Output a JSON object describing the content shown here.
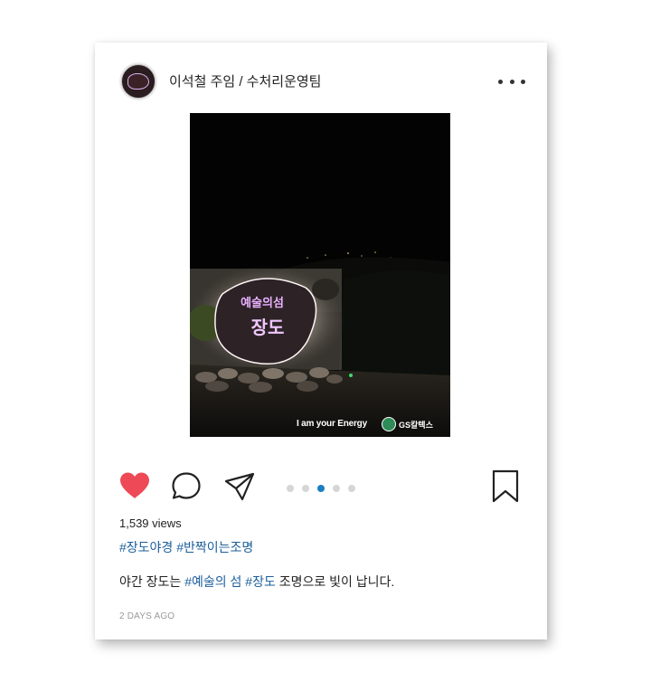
{
  "post": {
    "username": "이석철 주임 / 수처리운영팀",
    "avatar_icon": "sign-logo-avatar",
    "more_icon": "more-horizontal-icon",
    "photo_watermark": "I am your Energy",
    "photo_brand": "GS칼텍스",
    "carousel": {
      "count": 5,
      "active_index": 2
    },
    "liked": true,
    "like_color": "#ed4956",
    "accent_color": "#1b5e9a",
    "views": "1,539 views",
    "hashtags": "#장도야경 #반짝이는조명",
    "caption": {
      "part1": "야간 장도는 ",
      "tag1": "#예술의 섬",
      "space": " ",
      "tag2": "#장도",
      "part2": " 조명으로 빛이 납니다."
    },
    "timestamp": "2 DAYS AGO"
  }
}
